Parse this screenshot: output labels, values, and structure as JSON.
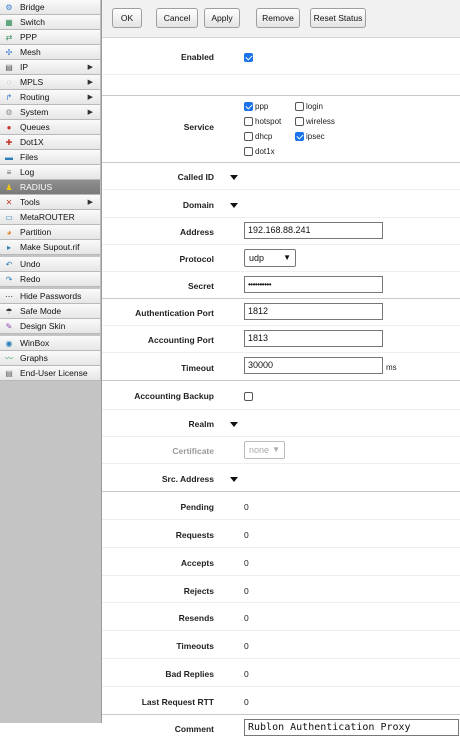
{
  "sidebar": {
    "items": [
      {
        "label": "Bridge",
        "icon": "bridge-icon",
        "glyph": "⚙",
        "color": "#3a7bd5",
        "submenu": false
      },
      {
        "label": "Switch",
        "icon": "switch-icon",
        "glyph": "▦",
        "color": "#2e8b57",
        "submenu": false
      },
      {
        "label": "PPP",
        "icon": "ppp-icon",
        "glyph": "⇄",
        "color": "#2e8b57",
        "submenu": false
      },
      {
        "label": "Mesh",
        "icon": "mesh-icon",
        "glyph": "✣",
        "color": "#3a7bd5",
        "submenu": false
      },
      {
        "label": "IP",
        "icon": "ip-icon",
        "glyph": "▤",
        "color": "#555555",
        "submenu": true
      },
      {
        "label": "MPLS",
        "icon": "mpls-icon",
        "glyph": "◌",
        "color": "#888888",
        "submenu": true
      },
      {
        "label": "Routing",
        "icon": "routing-icon",
        "glyph": "↱",
        "color": "#3a7bd5",
        "submenu": true
      },
      {
        "label": "System",
        "icon": "system-icon",
        "glyph": "⚙",
        "color": "#888888",
        "submenu": true
      },
      {
        "label": "Queues",
        "icon": "queues-icon",
        "glyph": "●",
        "color": "#c0392b",
        "submenu": false
      },
      {
        "label": "Dot1X",
        "icon": "dot1x-icon",
        "glyph": "✚",
        "color": "#c0392b",
        "submenu": false
      },
      {
        "label": "Files",
        "icon": "files-icon",
        "glyph": "▬",
        "color": "#2980b9",
        "submenu": false
      },
      {
        "label": "Log",
        "icon": "log-icon",
        "glyph": "≡",
        "color": "#666666",
        "submenu": false
      },
      {
        "label": "RADIUS",
        "icon": "radius-icon",
        "glyph": "♟",
        "color": "#f1c40f",
        "submenu": false,
        "active": true
      },
      {
        "label": "Tools",
        "icon": "tools-icon",
        "glyph": "✕",
        "color": "#c0392b",
        "submenu": true
      },
      {
        "label": "MetaROUTER",
        "icon": "metarouter-icon",
        "glyph": "▭",
        "color": "#2980b9",
        "submenu": false
      },
      {
        "label": "Partition",
        "icon": "partition-icon",
        "glyph": "◕",
        "color": "#e67e22",
        "submenu": false
      },
      {
        "label": "Make Supout.rif",
        "icon": "supout-icon",
        "glyph": "▸",
        "color": "#2980b9",
        "submenu": false
      }
    ],
    "items2": [
      {
        "label": "Undo",
        "icon": "undo-icon",
        "glyph": "↶",
        "color": "#2980b9"
      },
      {
        "label": "Redo",
        "icon": "redo-icon",
        "glyph": "↷",
        "color": "#2980b9"
      }
    ],
    "items3": [
      {
        "label": "Hide Passwords",
        "icon": "hide-passwords-icon",
        "glyph": "⋯",
        "color": "#333333"
      },
      {
        "label": "Safe Mode",
        "icon": "safe-mode-icon",
        "glyph": "☂",
        "color": "#333333"
      },
      {
        "label": "Design Skin",
        "icon": "design-skin-icon",
        "glyph": "✎",
        "color": "#8e44ad"
      }
    ],
    "items4": [
      {
        "label": "WinBox",
        "icon": "winbox-icon",
        "glyph": "◉",
        "color": "#2980b9"
      },
      {
        "label": "Graphs",
        "icon": "graphs-icon",
        "glyph": "〰",
        "color": "#27ae60"
      },
      {
        "label": "End-User License",
        "icon": "license-icon",
        "glyph": "▤",
        "color": "#666666"
      }
    ]
  },
  "toolbar": {
    "ok": "OK",
    "cancel": "Cancel",
    "apply": "Apply",
    "remove": "Remove",
    "reset_status": "Reset Status"
  },
  "form": {
    "enabled": {
      "label": "Enabled",
      "checked": true
    },
    "service": {
      "label": "Service",
      "options": [
        {
          "name": "ppp",
          "checked": true
        },
        {
          "name": "login",
          "checked": false
        },
        {
          "name": "hotspot",
          "checked": false
        },
        {
          "name": "wireless",
          "checked": false
        },
        {
          "name": "dhcp",
          "checked": false
        },
        {
          "name": "ipsec",
          "checked": true
        },
        {
          "name": "dot1x",
          "checked": false
        }
      ]
    },
    "called_id": {
      "label": "Called ID"
    },
    "domain": {
      "label": "Domain"
    },
    "address": {
      "label": "Address",
      "value": "192.168.88.241"
    },
    "protocol": {
      "label": "Protocol",
      "value": "udp"
    },
    "secret": {
      "label": "Secret",
      "value": "••••••••••"
    },
    "authentication_port": {
      "label": "Authentication Port",
      "value": "1812"
    },
    "accounting_port": {
      "label": "Accounting Port",
      "value": "1813"
    },
    "timeout": {
      "label": "Timeout",
      "value": "30000",
      "unit": "ms"
    },
    "accounting_backup": {
      "label": "Accounting Backup",
      "checked": false
    },
    "realm": {
      "label": "Realm"
    },
    "certificate": {
      "label": "Certificate",
      "value": "none"
    },
    "src_address": {
      "label": "Src. Address"
    },
    "pending": {
      "label": "Pending",
      "value": "0"
    },
    "requests": {
      "label": "Requests",
      "value": "0"
    },
    "accepts": {
      "label": "Accepts",
      "value": "0"
    },
    "rejects": {
      "label": "Rejects",
      "value": "0"
    },
    "resends": {
      "label": "Resends",
      "value": "0"
    },
    "timeouts": {
      "label": "Timeouts",
      "value": "0"
    },
    "bad_replies": {
      "label": "Bad Replies",
      "value": "0"
    },
    "last_request_rtt": {
      "label": "Last Request RTT",
      "value": "0"
    },
    "comment": {
      "label": "Comment",
      "value": "Rublon Authentication Proxy"
    }
  }
}
